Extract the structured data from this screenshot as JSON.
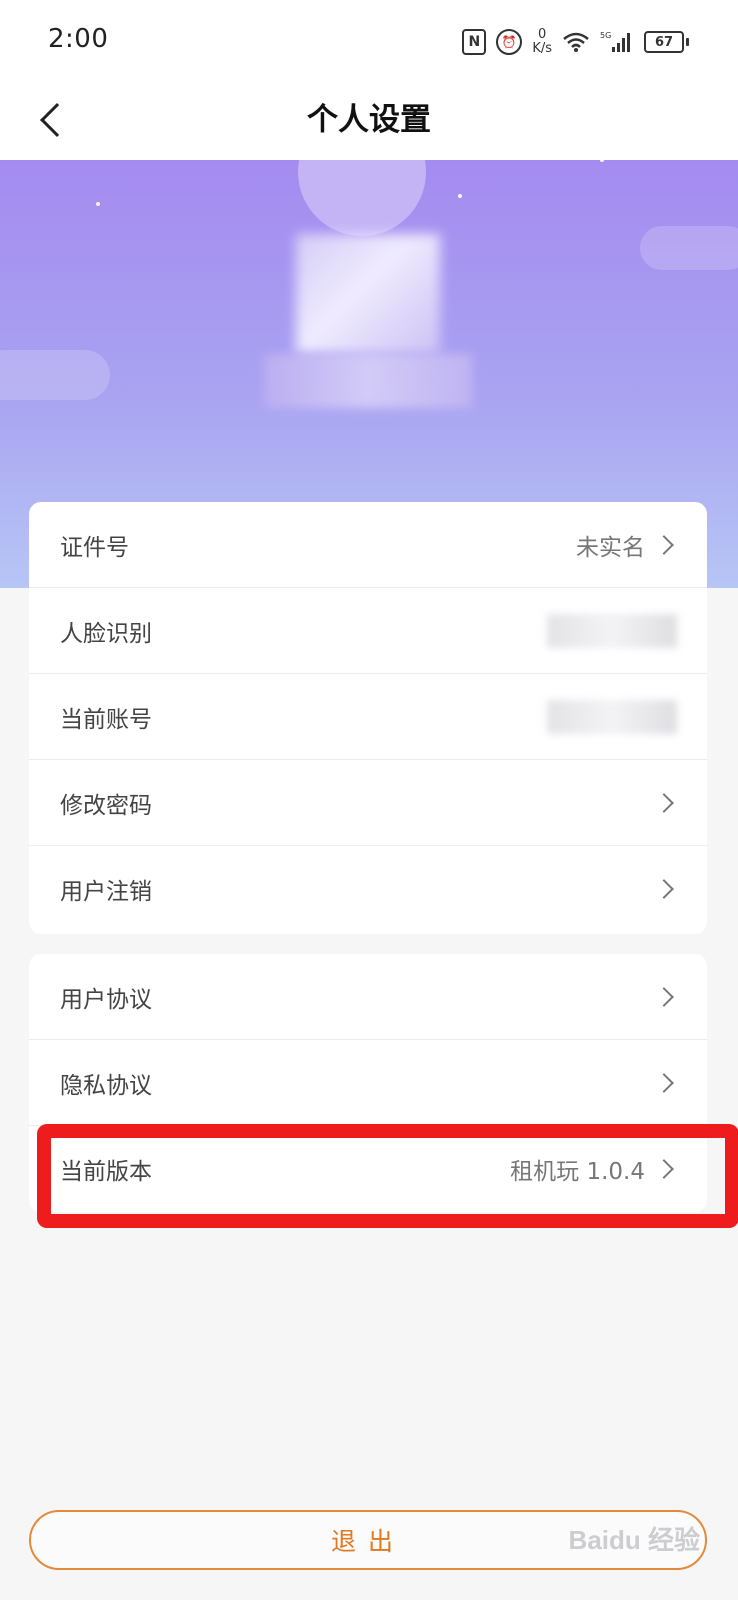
{
  "status_bar": {
    "time": "2:00",
    "nfc": "N",
    "speed_value": "0",
    "speed_unit": "K/s",
    "network": "5G",
    "battery": "67"
  },
  "header": {
    "back_icon": "chevron-left-icon",
    "title": "个人设置"
  },
  "account_section": [
    {
      "label": "证件号",
      "value": "未实名"
    },
    {
      "label": "人脸识别",
      "value": ""
    },
    {
      "label": "当前账号",
      "value": ""
    },
    {
      "label": "修改密码",
      "value": ""
    },
    {
      "label": "用户注销",
      "value": ""
    }
  ],
  "about_section": [
    {
      "label": "用户协议",
      "value": ""
    },
    {
      "label": "隐私协议",
      "value": ""
    },
    {
      "label": "当前版本",
      "value": "租机玩 1.0.4"
    }
  ],
  "logout_label": "退出",
  "watermark": "Baidu 经验",
  "colors": {
    "accent": "#e07a22",
    "banner_top": "#a48bf0",
    "banner_bottom": "#b7c6f5",
    "highlight": "#ee1c1c"
  }
}
